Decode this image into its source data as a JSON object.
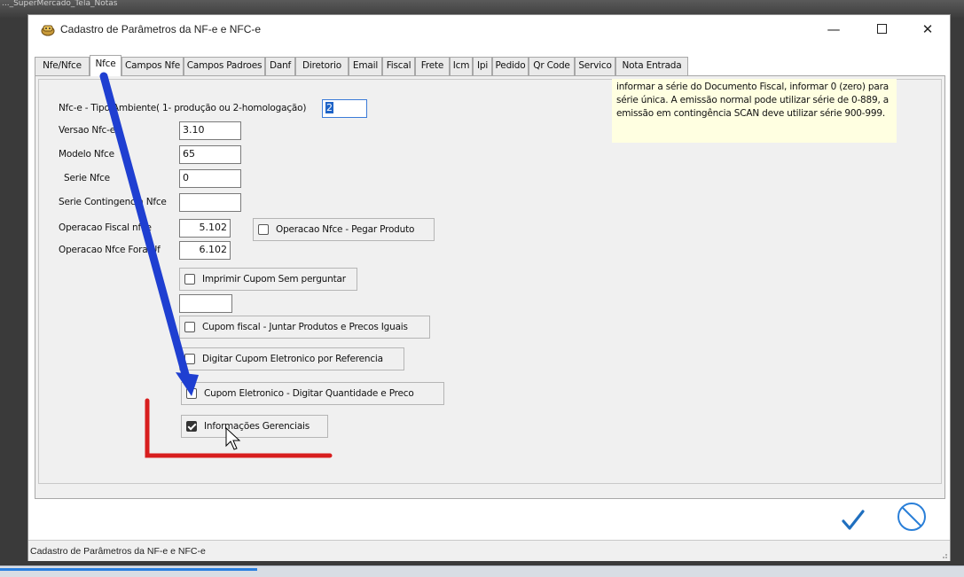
{
  "background": {
    "top_text": "..._SuperMercado_Tela_Notas"
  },
  "window": {
    "title": "Cadastro de Parâmetros da NF-e e NFC-e",
    "controls": {
      "minimize": "—",
      "maximize": "",
      "close": "✕"
    }
  },
  "tabs": [
    {
      "label": "Nfe/Nfce"
    },
    {
      "label": "Nfce",
      "active": true
    },
    {
      "label": "Campos Nfe"
    },
    {
      "label": "Campos Padroes"
    },
    {
      "label": "Danf"
    },
    {
      "label": "Diretorio"
    },
    {
      "label": "Email"
    },
    {
      "label": "Fiscal"
    },
    {
      "label": "Frete"
    },
    {
      "label": "Icm"
    },
    {
      "label": "Ipi"
    },
    {
      "label": "Pedido"
    },
    {
      "label": "Qr Code"
    },
    {
      "label": "Servico"
    },
    {
      "label": "Nota Entrada"
    }
  ],
  "form": {
    "ambiente_label": "Nfc-e - Tipo Ambiente( 1- produção ou 2-homologação)",
    "ambiente_value": "2",
    "versao_label": "Versao Nfc-e",
    "versao_value": "3.10",
    "modelo_label": "Modelo Nfce",
    "modelo_value": "65",
    "serie_label": "Serie Nfce",
    "serie_value": "0",
    "serie_cont_label": "Serie Contingencia Nfce",
    "serie_cont_value": "",
    "op_fiscal_label": "Operacao Fiscal nfce",
    "op_fiscal_value": "5.102",
    "op_fora_label": "Operacao Nfce Fora Uf",
    "op_fora_value": "6.102",
    "extra_value": ""
  },
  "checkboxes": {
    "pegar_produto": {
      "label": "Operacao Nfce - Pegar Produto",
      "checked": false
    },
    "imprimir_cupom": {
      "label": "Imprimir Cupom Sem perguntar",
      "checked": false
    },
    "juntar_produtos": {
      "label": "Cupom fiscal - Juntar Produtos e Precos Iguais",
      "checked": false
    },
    "digitar_referencia": {
      "label": "Digitar Cupom Eletronico por Referencia",
      "checked": false
    },
    "digitar_quantidade": {
      "label": "Cupom Eletronico - Digitar Quantidade e Preco",
      "checked": false
    },
    "informacoes_gerenciais": {
      "label": "Informações Gerenciais",
      "checked": true
    }
  },
  "tooltip": {
    "text": "informar a série do Documento Fiscal, informar 0 (zero) para série única. A emissão normal pode utilizar série de 0-889, a emissão em contingência SCAN deve utilizar série 900-999."
  },
  "footer": {
    "ok_icon": "checkmark-icon",
    "cancel_icon": "cancel-circle-icon"
  },
  "statusbar": {
    "text": "Cadastro de Parâmetros da NF-e e NFC-e"
  },
  "colors": {
    "annotation_arrow": "#1f3fd1",
    "annotation_bracket": "#d81e1e",
    "ok": "#1f6fbf",
    "cancel": "#2a7fd8"
  }
}
